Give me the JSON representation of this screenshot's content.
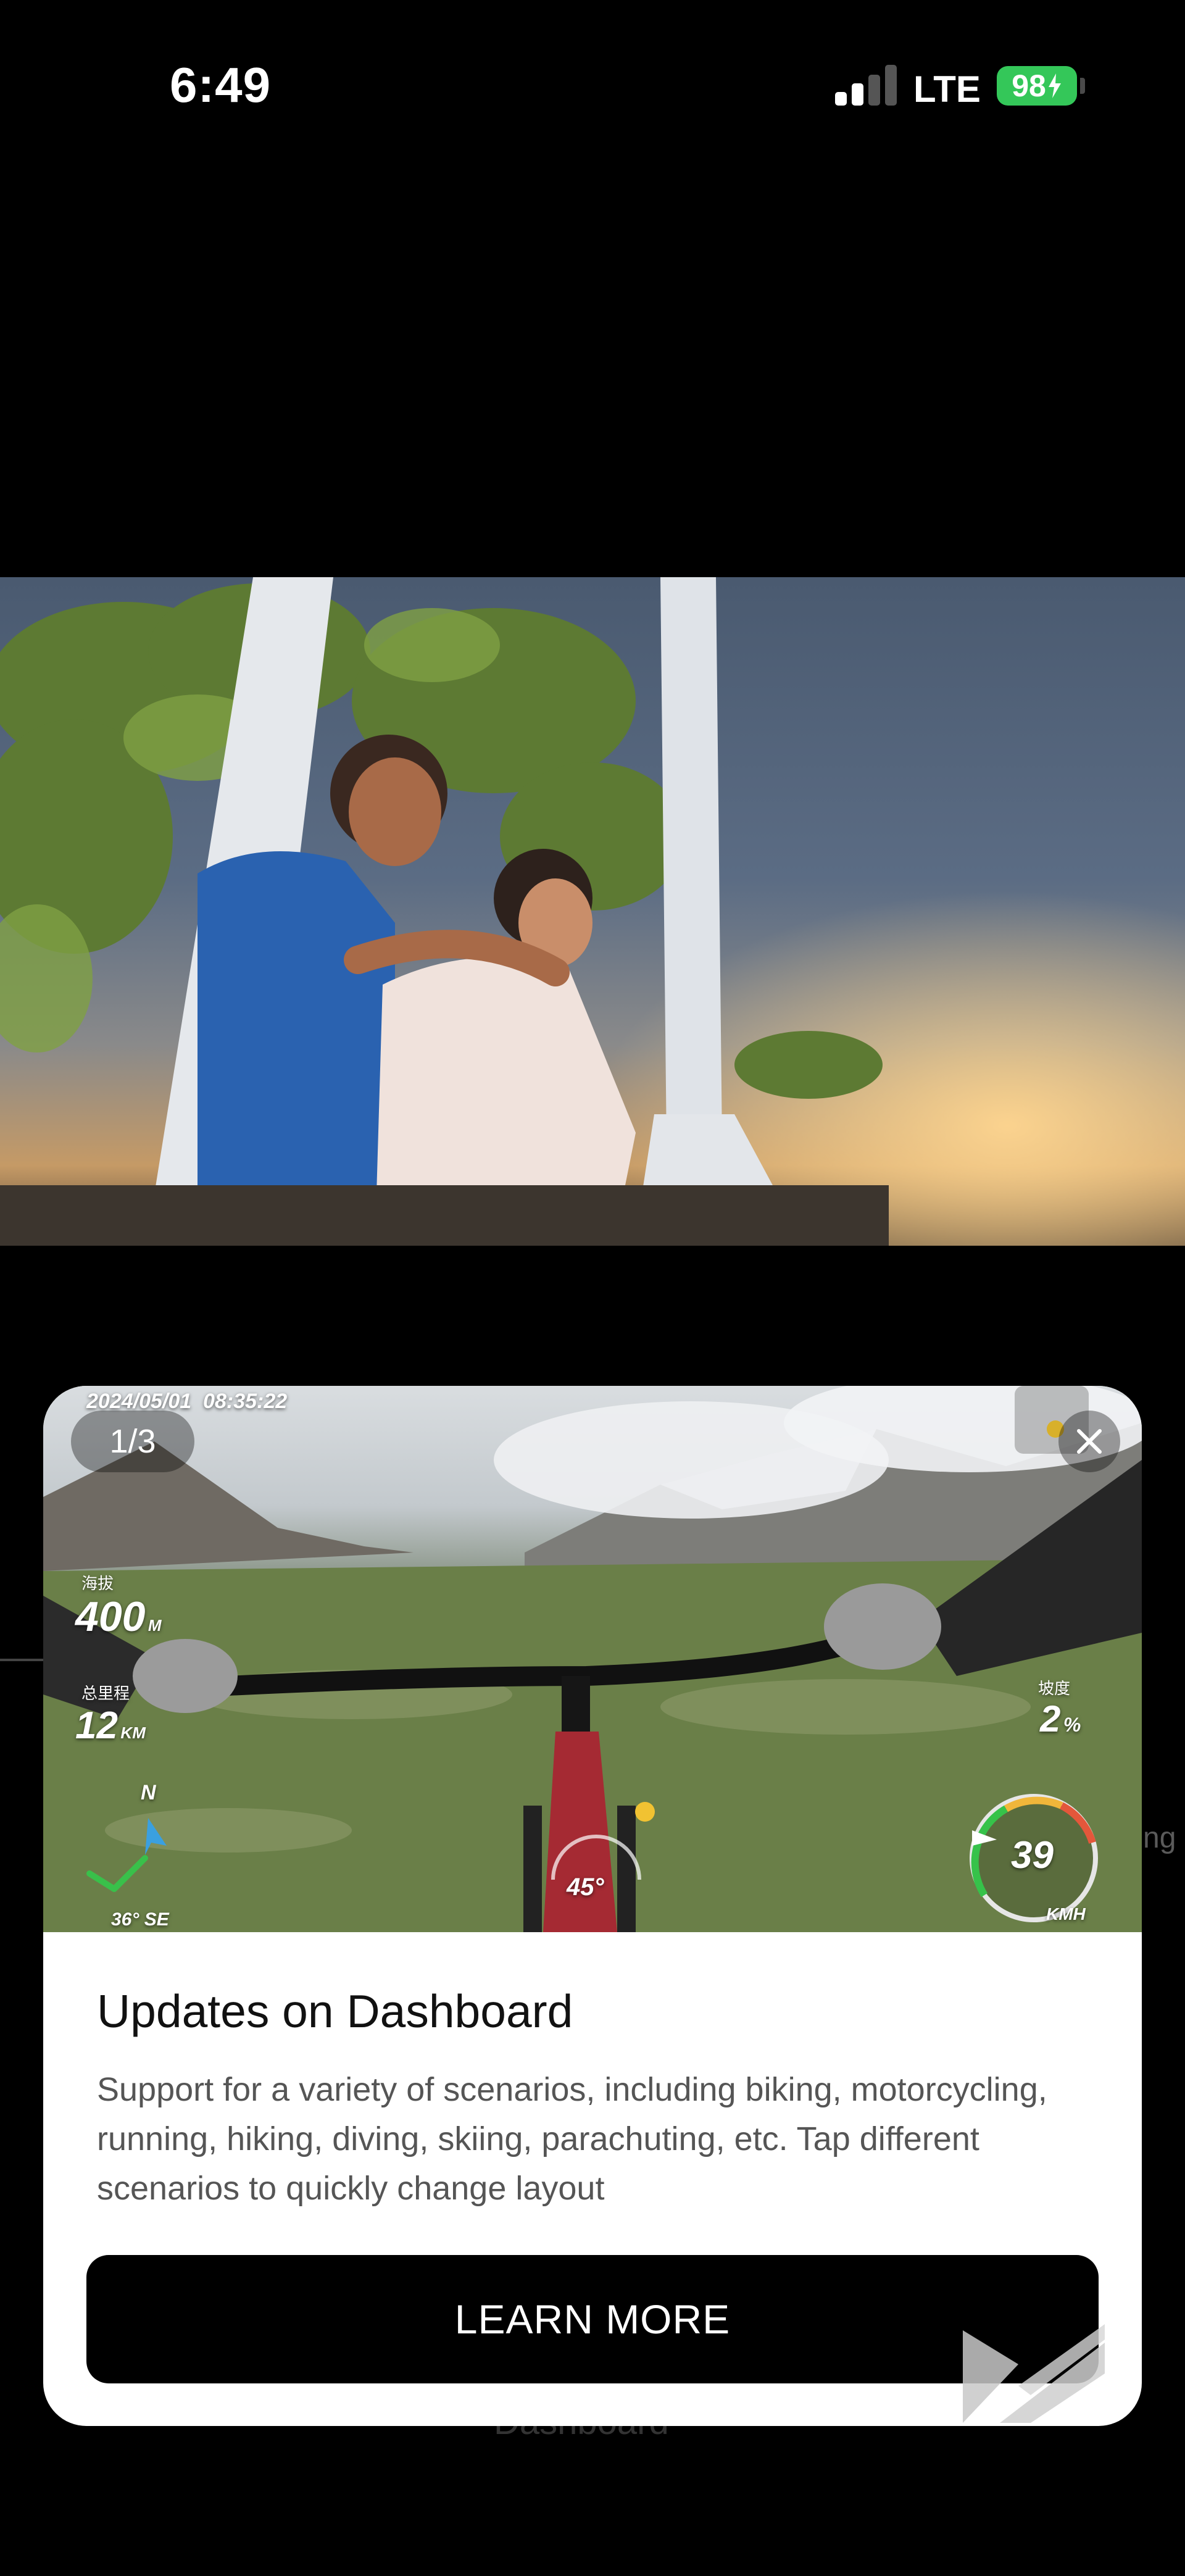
{
  "status_bar": {
    "time": "6:49",
    "network": "LTE",
    "battery": "98"
  },
  "background": {
    "side_label": "ng",
    "bottom_label": "Dashboard"
  },
  "modal": {
    "page_indicator": "1/3",
    "hero": {
      "timestamp": "2024/05/01  08:35:22",
      "altitude_label": "海拔",
      "altitude_value": "400",
      "altitude_unit": "M",
      "distance_label": "总里程",
      "distance_value": "12",
      "distance_unit": "KM",
      "compass_label": "N",
      "heading": "36° SE",
      "slope_label": "坡度",
      "slope_value": "2",
      "slope_unit": "%",
      "lean_angle": "45°",
      "speed_value": "39",
      "speed_unit": "KMH",
      "speed_fraction": 0.65
    },
    "title": "Updates on Dashboard",
    "description": "Support for a variety of scenarios, including biking, motorcycling, running, hiking, diving, skiing, parachuting, etc. Tap different scenarios to quickly change layout",
    "cta_label": "LEARN MORE"
  }
}
